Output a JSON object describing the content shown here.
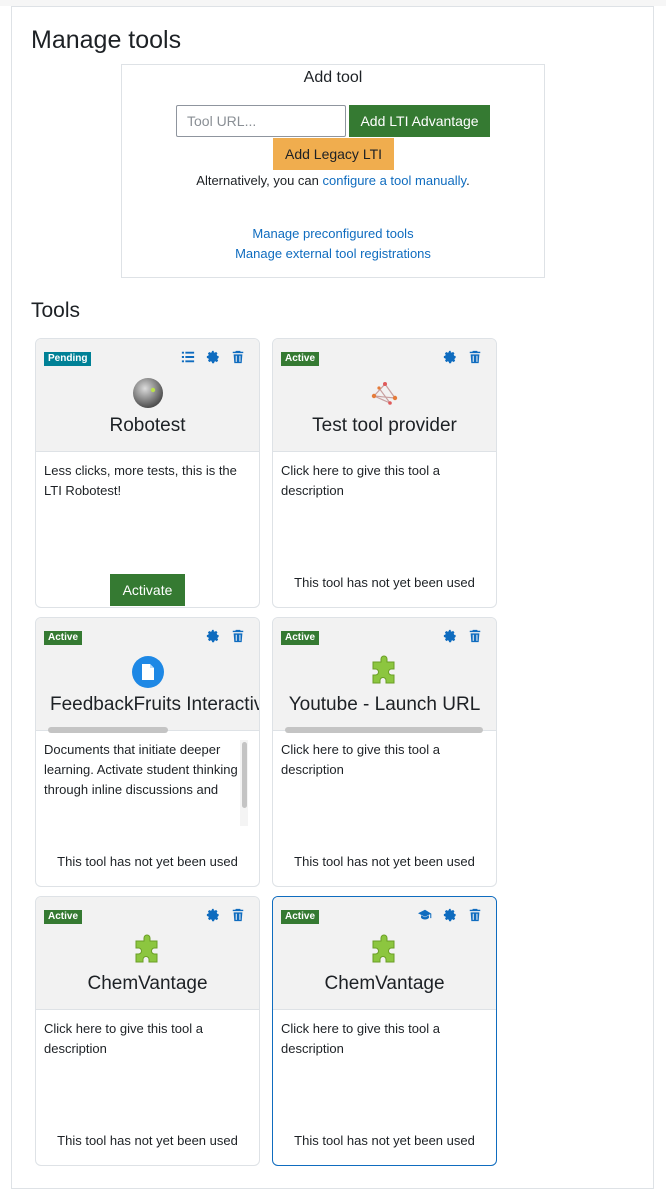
{
  "page": {
    "title": "Manage tools"
  },
  "add_tool": {
    "title": "Add tool",
    "url_placeholder": "Tool URL...",
    "add_advantage_label": "Add LTI Advantage",
    "add_legacy_label": "Add Legacy LTI",
    "alt_text_before": "Alternatively, you can ",
    "alt_link": "configure a tool manually",
    "alt_text_after": ".",
    "manage_preconfigured": "Manage preconfigured tools",
    "manage_registrations": "Manage external tool registrations"
  },
  "tools_heading": "Tools",
  "colors": {
    "active": "#357a32",
    "pending": "#008196",
    "link": "#0f6cbf",
    "legacy": "#f0ad4e"
  },
  "cards": [
    {
      "status": "Pending",
      "name": "Robotest",
      "icon": "robot-ball-icon",
      "actions": [
        "list-icon",
        "gear-icon",
        "trash-icon"
      ],
      "description": "Less clicks, more tests, this is the LTI Robotest!",
      "button": "Activate"
    },
    {
      "status": "Active",
      "name": "Test tool provider",
      "icon": "network-graph-icon",
      "actions": [
        "gear-icon",
        "trash-icon"
      ],
      "description": "Click here to give this tool a description",
      "usage": "This tool has not yet been used"
    },
    {
      "status": "Active",
      "name": "FeedbackFruits Interactive",
      "icon": "document-circle-icon",
      "actions": [
        "gear-icon",
        "trash-icon"
      ],
      "description": "Documents that initiate deeper learning. Activate student thinking through inline discussions and",
      "usage": "This tool has not yet been used"
    },
    {
      "status": "Active",
      "name": "Youtube - Launch URL",
      "icon": "puzzle-icon",
      "actions": [
        "gear-icon",
        "trash-icon"
      ],
      "description": "Click here to give this tool a description",
      "usage": "This tool has not yet been used"
    },
    {
      "status": "Active",
      "name": "ChemVantage",
      "icon": "puzzle-icon",
      "actions": [
        "gear-icon",
        "trash-icon"
      ],
      "description": "Click here to give this tool a description",
      "usage": "This tool has not yet been used"
    },
    {
      "status": "Active",
      "name": "ChemVantage",
      "icon": "puzzle-icon",
      "actions": [
        "graduation-cap-icon",
        "gear-icon",
        "trash-icon"
      ],
      "description": "Click here to give this tool a description",
      "usage": "This tool has not yet been used"
    }
  ]
}
